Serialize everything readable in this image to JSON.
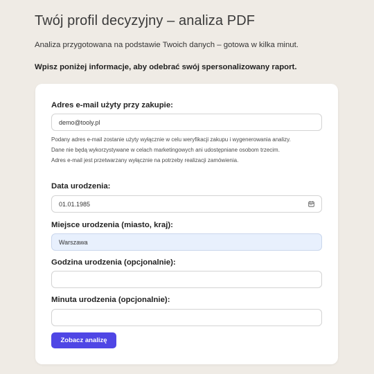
{
  "header": {
    "title": "Twój profil decyzyjny – analiza PDF",
    "subtitle": "Analiza przygotowana na podstawie Twoich danych – gotowa w kilka minut.",
    "instruction": "Wpisz poniżej informacje, aby odebrać swój spersonalizowany raport."
  },
  "form": {
    "email": {
      "label": "Adres e-mail użyty przy zakupie:",
      "value": "demo@tooly.pl"
    },
    "notice": [
      "Podany adres e-mail zostanie użyty wyłącznie w celu weryfikacji zakupu i wygenerowania analizy.",
      "Dane nie będą wykorzystywane w celach marketingowych ani udostępniane osobom trzecim.",
      "Adres e-mail jest przetwarzany wyłącznie na potrzeby realizacji zamówienia."
    ],
    "birth_date": {
      "label": "Data urodzenia:",
      "value": "01.01.1985",
      "icon": "calendar-icon"
    },
    "birth_place": {
      "label": "Miejsce urodzenia (miasto, kraj):",
      "value": "Warszawa"
    },
    "birth_hour": {
      "label": "Godzina urodzenia (opcjonalnie):",
      "value": ""
    },
    "birth_minute": {
      "label": "Minuta urodzenia (opcjonalnie):",
      "value": ""
    },
    "submit_label": "Zobacz analizę"
  },
  "colors": {
    "background": "#efebe5",
    "card": "#ffffff",
    "accent": "#4f46e5",
    "autofill": "#e8f0fd"
  }
}
